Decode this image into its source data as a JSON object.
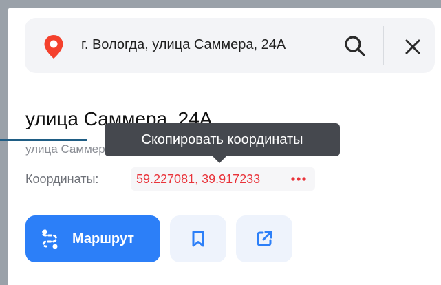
{
  "search": {
    "query": "г. Вологда, улица Саммера, 24А",
    "icons": {
      "location": "pin-icon",
      "search": "search-icon",
      "close": "close-icon"
    }
  },
  "place": {
    "title": "улица Саммера, 24А",
    "subtitle": "улица Саммера, 24А, Вологда",
    "coordinates_label": "Координаты:",
    "coordinates_value": "59.227081, 39.917233"
  },
  "tooltip": {
    "text": "Скопировать координаты"
  },
  "actions": {
    "route_label": "Маршрут",
    "icons": {
      "route": "route-icon",
      "bookmark": "bookmark-icon",
      "share": "share-icon",
      "more": "more-dots-icon"
    }
  },
  "colors": {
    "accent": "#2c7ff8",
    "pin": "#f4412d",
    "coordinates": "#e9333a",
    "tooltip_bg": "#45484e",
    "panel_frame": "#9aa1a9"
  }
}
